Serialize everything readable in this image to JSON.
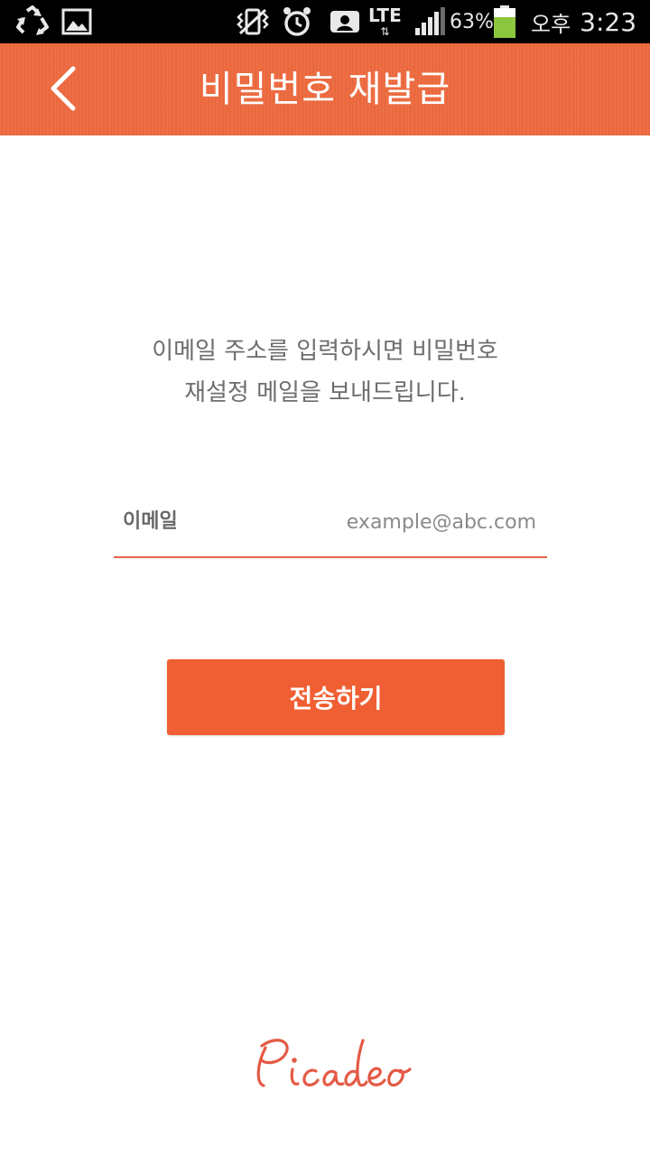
{
  "status_bar": {
    "icons": [
      "recycle-icon",
      "gallery-icon",
      "vibrate-icon",
      "alarm-icon",
      "contact-icon",
      "signal-icon",
      "battery-icon"
    ],
    "network": "LTE",
    "battery": "63%",
    "ampm": "오후",
    "time": "3:23"
  },
  "header": {
    "title": "비밀번호 재발급",
    "back_icon": "chevron-left-icon"
  },
  "instruction": {
    "line1": "이메일 주소를 입력하시면 비밀번호",
    "line2": "재설정 메일을 보내드립니다."
  },
  "email": {
    "label": "이메일",
    "value": "",
    "placeholder": "example@abc.com"
  },
  "submit": {
    "label": "전송하기"
  },
  "footer": {
    "logo_text": "Picadeo"
  },
  "colors": {
    "accent": "#ee6a3f",
    "button": "#ef5f33",
    "underline": "#e8604a",
    "logo": "#e45a45"
  }
}
